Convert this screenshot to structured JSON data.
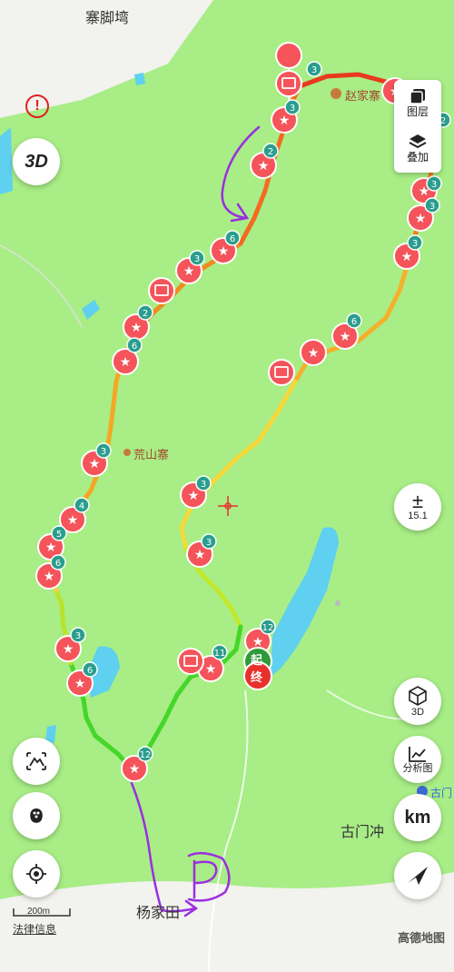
{
  "place_labels": {
    "zhaijiaowan": "寨脚塆",
    "zhaojiazhai": "赵家寨",
    "huangshanzhai": "荒山寨",
    "gumenchong": "古门冲",
    "yangjiatian": "杨家田",
    "gumen_partial": "古门"
  },
  "controls": {
    "threed_toggle": "3D",
    "layers_label": "图层",
    "overlay_label": "叠加",
    "scale_value": "15.1",
    "cube_3d_label": "3D",
    "analysis_label": "分析图",
    "km_label": "km",
    "scale_bar_label": "200m",
    "legal_info": "法律信息",
    "brand": "高德地图"
  },
  "markers": {
    "start": "起",
    "end": "终"
  },
  "badges": [
    "3",
    "3",
    "2",
    "2",
    "3",
    "3",
    "3",
    "3",
    "3",
    "6",
    "3",
    "2",
    "6",
    "3",
    "4",
    "5",
    "6",
    "3",
    "6",
    "12",
    "11",
    "12",
    "3",
    "3",
    "6",
    "3"
  ],
  "colors": {
    "map_bg": "#a8ed86",
    "water": "#5fd0ef",
    "pin_red": "#f4545a",
    "badge_teal": "#2a9e8e",
    "start_green": "#2f9a3a",
    "end_red": "#e8302c",
    "hand_drawn_purple": "#9a2ee0"
  },
  "icons": [
    "alert-icon",
    "3d-icon",
    "layers-icon",
    "overlay-icon",
    "zoom-scale-icon",
    "cube-icon",
    "analysis-chart-icon",
    "measure-icon",
    "footprint-icon",
    "locate-icon",
    "navigate-icon",
    "photo-icon",
    "poi-icon",
    "parking-sketch-icon"
  ]
}
